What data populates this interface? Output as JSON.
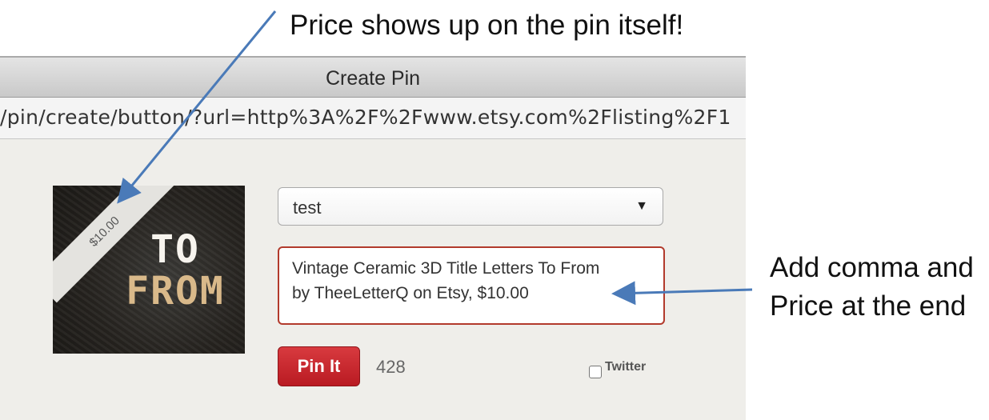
{
  "window": {
    "title": "Create Pin",
    "url": "/pin/create/button/?url=http%3A%2F%2Fwww.etsy.com%2Flisting%2F1"
  },
  "pin": {
    "price_ribbon": "$10.00",
    "image_letters_top": "TO",
    "image_letters_bottom": "FROM",
    "board_value": "test",
    "board_arrow": "▼",
    "description_line1": "Vintage Ceramic 3D Title Letters  To From",
    "description_line2": "by TheeLetterQ on Etsy, $10.00",
    "pin_button_label": "Pin It",
    "pin_count": "428",
    "twitter_label": "Twitter",
    "twitter_checked": false
  },
  "annotations": {
    "top": "Price shows up on the pin itself!",
    "right_line1": "Add comma and",
    "right_line2": "Price at the end",
    "arrow_color": "#4a7ab8"
  },
  "colors": {
    "pin_button": "#c8242b",
    "description_border": "#b23a2c"
  }
}
